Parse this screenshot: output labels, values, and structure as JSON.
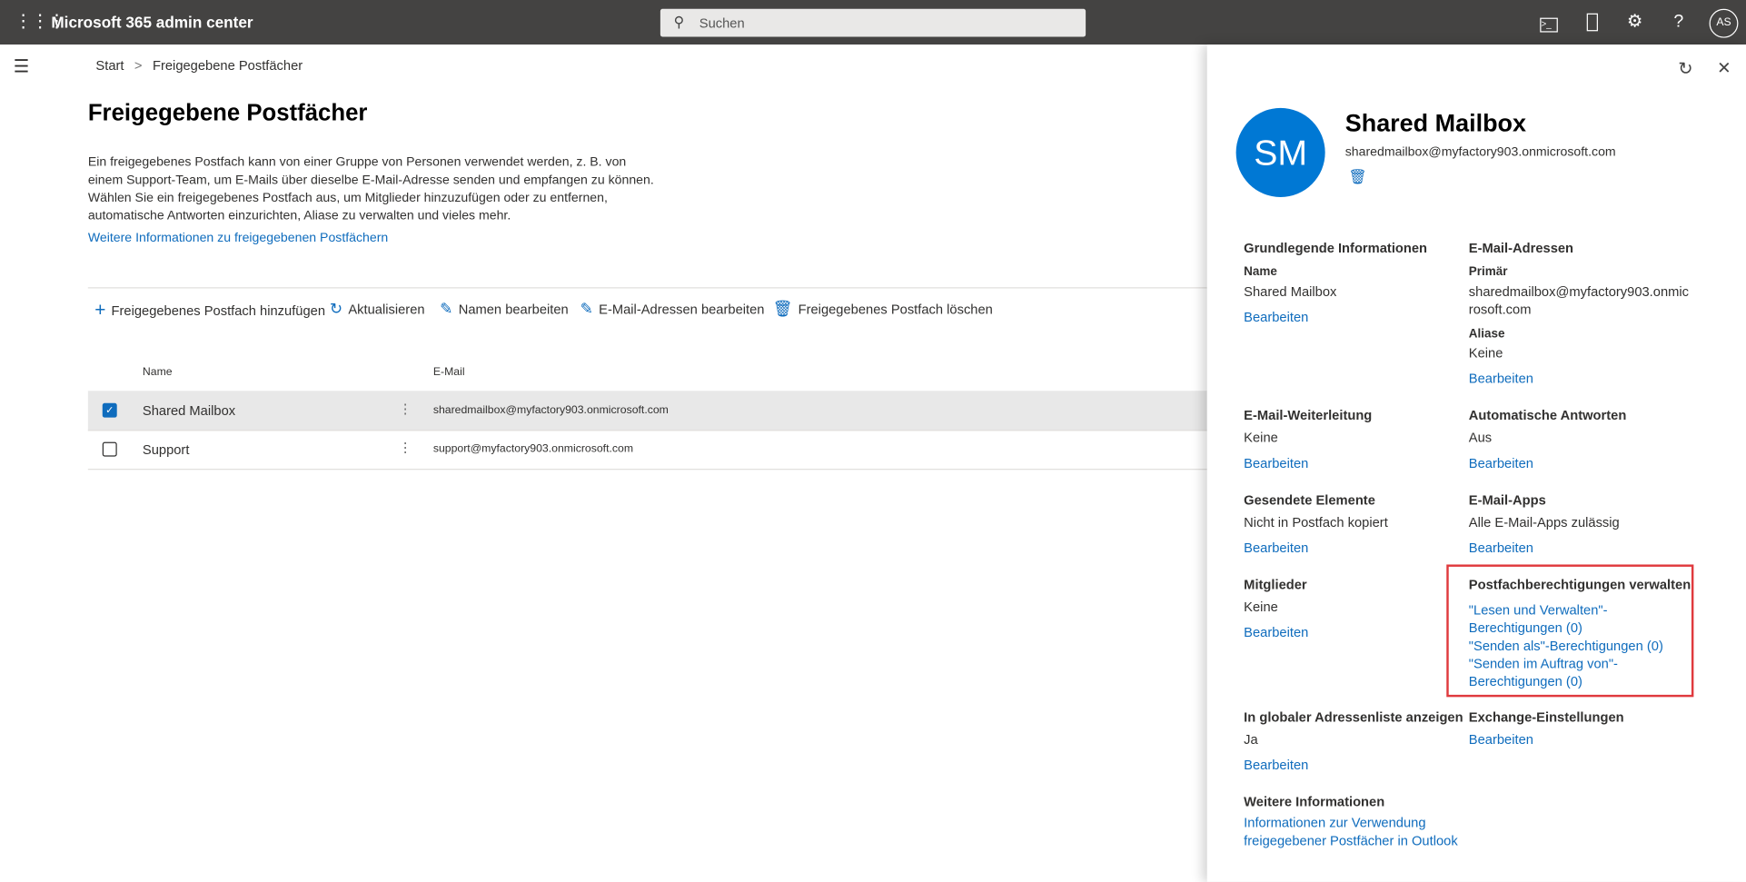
{
  "topbar": {
    "app_title": "Microsoft 365 admin center",
    "search_placeholder": "Suchen",
    "avatar_initials": "AS",
    "icons": [
      "waffle-icon",
      "search-icon",
      "terminal-icon",
      "mobile-icon",
      "gear-icon",
      "help-icon"
    ]
  },
  "breadcrumb": {
    "home": "Start",
    "separator": ">",
    "current": "Freigegebene Postfächer"
  },
  "page": {
    "title": "Freigegebene Postfächer",
    "description": [
      "Ein freigegebenes Postfach kann von einer Gruppe von Personen verwendet werden, z. B. von",
      "einem Support-Team, um E-Mails über dieselbe E-Mail-Adresse senden und empfangen zu können.",
      "Wählen Sie ein freigegebenes Postfach aus, um Mitglieder hinzuzufügen oder zu entfernen,",
      "automatische Antworten einzurichten, Aliase zu verwalten und vieles mehr."
    ],
    "learn_more": "Weitere Informationen zu freigegebenen Postfächern"
  },
  "toolbar": {
    "add": "Freigegebenes Postfach hinzufügen",
    "refresh": "Aktualisieren",
    "edit_name": "Namen bearbeiten",
    "edit_email": "E-Mail-Adressen bearbeiten",
    "delete": "Freigegebenes Postfach löschen"
  },
  "table": {
    "columns": [
      "Name",
      "E-Mail"
    ],
    "rows": [
      {
        "name": "Shared Mailbox",
        "email": "sharedmailbox@myfactory903.onmicrosoft.com",
        "selected": true
      },
      {
        "name": "Support",
        "email": "support@myfactory903.onmicrosoft.com",
        "selected": false
      }
    ]
  },
  "panel": {
    "initials": "SM",
    "name": "Shared Mailbox",
    "email": "sharedmailbox@myfactory903.onmicrosoft.com",
    "avatar_color": "#0078d4",
    "edit": "Bearbeiten",
    "basic": {
      "heading": "Grundlegende Informationen",
      "label": "Name",
      "value": "Shared Mailbox"
    },
    "emails": {
      "heading": "E-Mail-Adressen",
      "primary_label": "Primär",
      "primary_1": "sharedmailbox@myfactory903.onmic",
      "primary_2": "rosoft.com",
      "alias_label": "Aliase",
      "alias_value": "Keine"
    },
    "forwarding": {
      "heading": "E-Mail-Weiterleitung",
      "value": "Keine"
    },
    "auto_reply": {
      "heading": "Automatische Antworten",
      "value": "Aus"
    },
    "sent_items": {
      "heading": "Gesendete Elemente",
      "value": "Nicht in Postfach kopiert"
    },
    "email_apps": {
      "heading": "E-Mail-Apps",
      "value": "Alle E-Mail-Apps zulässig"
    },
    "members": {
      "heading": "Mitglieder",
      "value": "Keine"
    },
    "permissions": {
      "heading": "Postfachberechtigungen verwalten",
      "links": [
        "\"Lesen und Verwalten\"-",
        "Berechtigungen (0)",
        "\"Senden als\"-Berechtigungen (0)",
        "\"Senden im Auftrag von\"-",
        "Berechtigungen (0)"
      ],
      "highlight_color": "#e03a3e"
    },
    "gal": {
      "heading": "In globaler Adressenliste anzeigen",
      "value": "Ja"
    },
    "exchange": {
      "heading": "Exchange-Einstellungen"
    },
    "more_info": {
      "heading": "Weitere Informationen",
      "link_1": "Informationen zur Verwendung",
      "link_2": "freigegebener Postfächer in Outlook"
    }
  }
}
